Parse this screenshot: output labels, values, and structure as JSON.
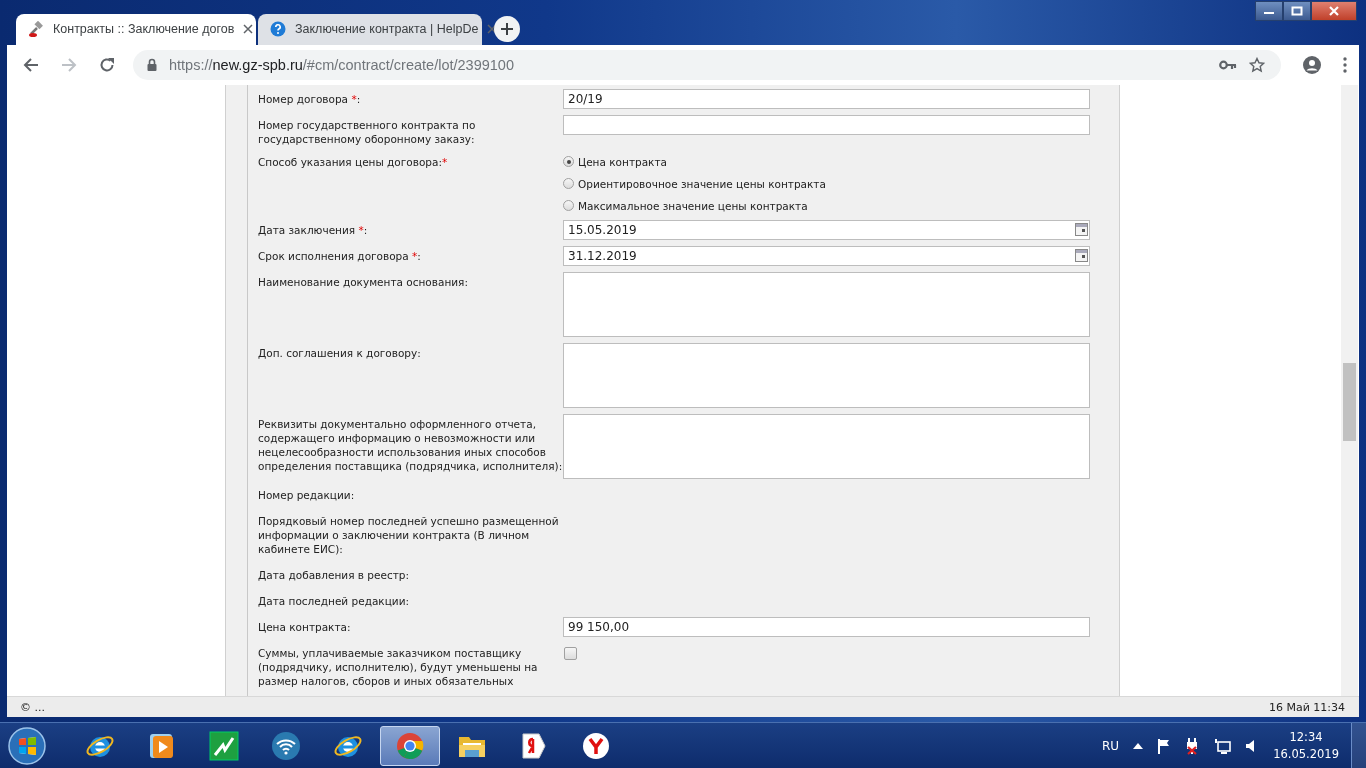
{
  "browser": {
    "tabs": [
      {
        "kind": "gavel",
        "title": "Контракты :: Заключение догов",
        "selected": true
      },
      {
        "kind": "help",
        "title": "Заключение контракта | HelpDe",
        "selected": false
      }
    ],
    "url": {
      "scheme": "https://",
      "host": "new.gz-spb.ru",
      "path": "/#cm/contract/create/lot/2399100"
    }
  },
  "form": {
    "rows": [
      {
        "label": "Номер договора ",
        "mark": "*",
        "end": ":",
        "kind": "text",
        "value": "20/19"
      },
      {
        "label": "Номер государственного контракта по государственному оборонному заказу:",
        "kind": "text"
      },
      {
        "label": "Способ указания цены договора:",
        "mark": "*",
        "kind": "radio",
        "options": [
          {
            "label": "Цена контракта",
            "selected": true
          },
          {
            "label": "Ориентировочное значение цены контракта",
            "selected": false
          },
          {
            "label": "Максимальное значение цены контракта",
            "selected": false
          }
        ]
      },
      {
        "label": "Дата заключения ",
        "mark": "*",
        "end": ":",
        "kind": "date",
        "value": "15.05.2019"
      },
      {
        "label": "Срок исполнения договора ",
        "mark": "*",
        "end": ":",
        "kind": "date",
        "value": "31.12.2019"
      },
      {
        "label": "Наименование документа основания:",
        "kind": "textarea"
      },
      {
        "label": "Доп. соглашения к договору:",
        "kind": "textarea"
      },
      {
        "label": "Реквизиты документально оформленного отчета, содержащего информацию о невозможности или нецелесообразности использования иных способов определения поставщика (подрядчика, исполнителя):",
        "kind": "textarea"
      },
      {
        "label": "Номер редакции:",
        "kind": "none"
      },
      {
        "label": "Порядковый номер последней успешно размещенной информации о заключении контракта (В личном кабинете ЕИС):",
        "kind": "none"
      },
      {
        "label": "Дата добавления в реестр:",
        "kind": "none"
      },
      {
        "label": "Дата последней редакции:",
        "kind": "none"
      },
      {
        "label": "Цена контракта:",
        "kind": "text",
        "value": "99 150,00"
      },
      {
        "label": "Суммы, уплачиваемые заказчиком поставщику (подрядчику, исполнителю), будут уменьшены на размер налогов, сборов и иных обязательных",
        "kind": "checkbox",
        "checked": false
      }
    ]
  },
  "status_bar": {
    "left": "© ...",
    "right": "16 Май 11:34"
  },
  "taskbar": {
    "apps": [
      {
        "kind": "ie",
        "selected": false
      },
      {
        "kind": "media",
        "selected": false
      },
      {
        "kind": "chart",
        "selected": false
      },
      {
        "kind": "wifi",
        "selected": false
      },
      {
        "kind": "ie",
        "selected": false
      },
      {
        "kind": "chrome",
        "selected": true
      },
      {
        "kind": "folder",
        "selected": false
      },
      {
        "kind": "tag",
        "selected": false
      },
      {
        "kind": "ybrowser",
        "selected": false
      }
    ],
    "language": "RU",
    "time": "12:34",
    "date": "16.05.2019"
  }
}
